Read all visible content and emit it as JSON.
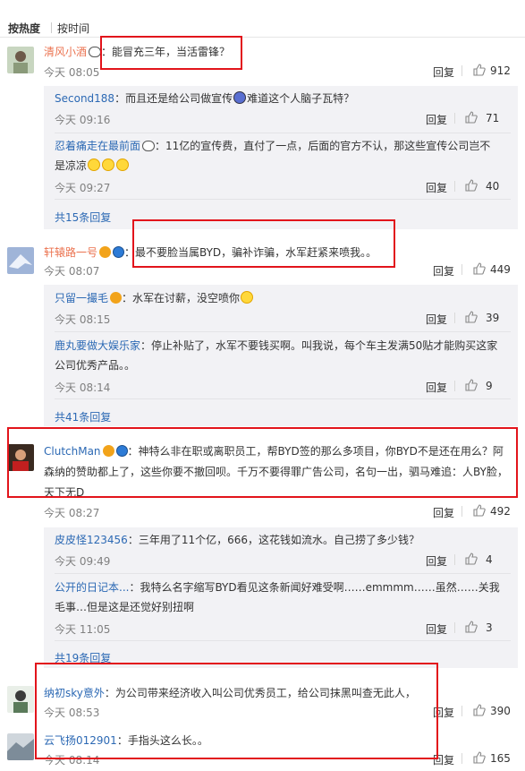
{
  "sort": {
    "hot": "按热度",
    "time": "按时间"
  },
  "comments": [
    {
      "user": "清风小酒",
      "text": "：能冒充三年，当活雷锋？",
      "time": "今天 08:05",
      "reply": "回复",
      "likes": "912",
      "subs": [
        {
          "user": "Second188",
          "text": "：而且还是给公司做宣传",
          "text2": "难道这个人脑子瓦特？",
          "time": "今天 09:16",
          "reply": "回复",
          "likes": "71"
        },
        {
          "user": "忍着痛走在最前面",
          "text": "：11亿的宣传费，直付了一点，后面的官方不认，那这些宣传公司岂不",
          "text2": "是凉凉",
          "time": "今天 09:27",
          "reply": "回复",
          "likes": "40"
        }
      ],
      "more": "共15条回复"
    },
    {
      "user": "轩辕路一号",
      "text": "：最不要脸当属BYD，骗补诈骗，水军赶紧来喷我。。",
      "time": "今天 08:07",
      "reply": "回复",
      "likes": "449",
      "subs": [
        {
          "user": "只留一撮毛",
          "text": "：水军在讨薪，没空喷你",
          "time": "今天 08:15",
          "reply": "回复",
          "likes": "39"
        },
        {
          "user": "鹿丸要做大娱乐家",
          "text": "：停止补贴了，水军不要钱买啊。叫我说，每个车主发满50贴才能购买这家",
          "text2": "公司优秀产品。。",
          "time": "今天 08:14",
          "reply": "回复",
          "likes": "9"
        }
      ],
      "more": "共41条回复"
    },
    {
      "user": "ClutchMan",
      "text": "：神特么非在职或离职员工，帮BYD签的那么多项目，你BYD不是还在用么？阿",
      "text2": "森纳的赞助都上了，这些你要不撤回呗。千万不要得罪广告公司，名句一出，驷马难追：人BY脸，",
      "text3": "天下无D",
      "time": "今天 08:27",
      "reply": "回复",
      "likes": "492",
      "subs": [
        {
          "user": "皮皮怪123456",
          "text": "：三年用了11个亿，666，这花钱如流水。自己捞了多少钱？",
          "time": "今天 09:49",
          "reply": "回复",
          "likes": "4"
        },
        {
          "user": "公开的日记本...",
          "text": "：我特么名字缩写BYD看见这条新闻好难受啊……emmmm……虽然……关我",
          "text2": "毛事…但是这是还觉好别扭啊",
          "time": "今天 11:05",
          "reply": "回复",
          "likes": "3"
        }
      ],
      "more": "共19条回复"
    },
    {
      "user": "纳初sky意外",
      "text": "：为公司带来经济收入叫公司优秀员工，给公司抹黑叫查无此人，",
      "time": "今天 08:53",
      "reply": "回复",
      "likes": "390"
    },
    {
      "user": "云飞扬012901",
      "text": "：手指头这么长。。",
      "time": "今天 08:14",
      "reply": "回复",
      "likes": "165"
    }
  ]
}
